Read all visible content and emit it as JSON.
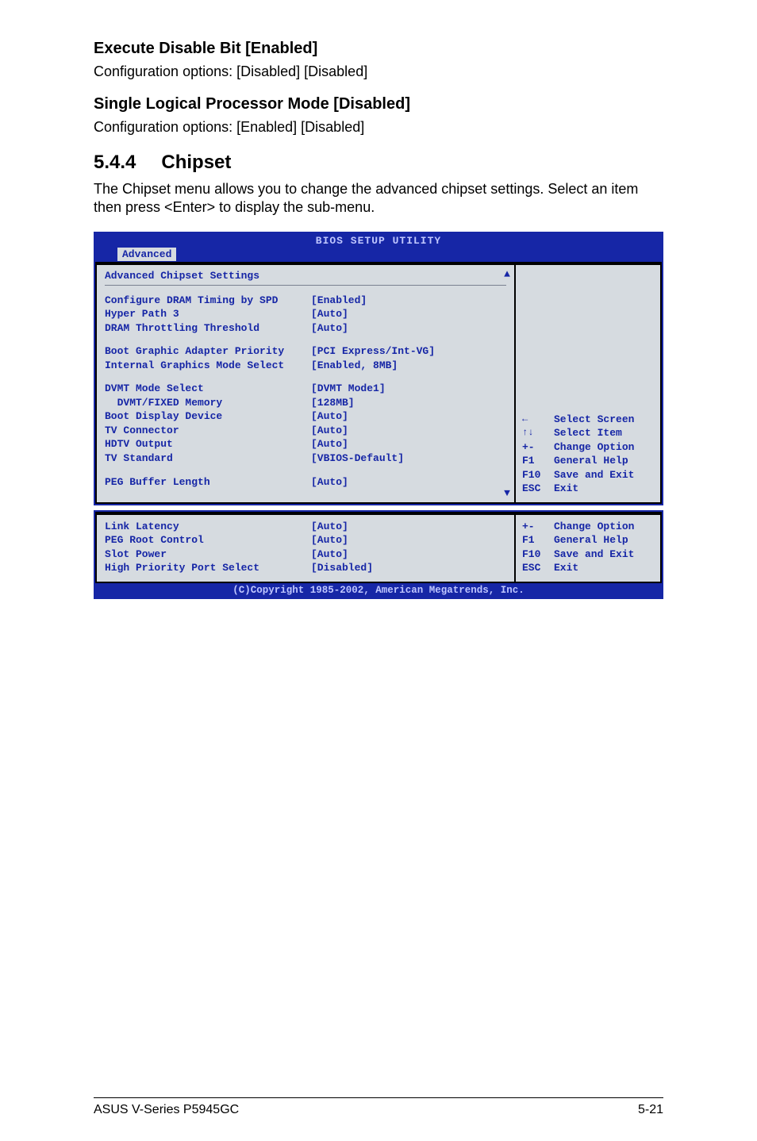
{
  "headings": {
    "h1": "Execute Disable Bit [Enabled]",
    "h1_body": "Configuration options: [Disabled] [Disabled]",
    "h2": "Single Logical Processor Mode [Disabled]",
    "h2_body": "Configuration options: [Enabled] [Disabled]",
    "sec_num": "5.4.4",
    "sec_title": "Chipset",
    "sec_body": "The Chipset menu allows you to change the advanced chipset settings. Select an item then press <Enter> to display the sub-menu."
  },
  "bios": {
    "title": "BIOS SETUP UTILITY",
    "tab": "Advanced",
    "panel_title": "Advanced Chipset Settings",
    "settings1": [
      {
        "label": "Configure DRAM Timing by SPD",
        "value": "[Enabled]"
      },
      {
        "label": "Hyper Path 3",
        "value": "[Auto]"
      },
      {
        "label": "DRAM Throttling Threshold",
        "value": "[Auto]"
      }
    ],
    "settings2": [
      {
        "label": "Boot Graphic Adapter Priority",
        "value": "[PCI Express/Int-VG]"
      },
      {
        "label": "Internal Graphics Mode Select",
        "value": "[Enabled, 8MB]"
      }
    ],
    "settings3": [
      {
        "label": "DVMT Mode Select",
        "value": "[DVMT Mode1]"
      },
      {
        "label": "  DVMT/FIXED Memory",
        "value": "[128MB]"
      },
      {
        "label": "Boot Display Device",
        "value": "[Auto]"
      },
      {
        "label": "TV Connector",
        "value": "[Auto]"
      },
      {
        "label": "HDTV Output",
        "value": "[Auto]"
      },
      {
        "label": "TV Standard",
        "value": "[VBIOS-Default]"
      }
    ],
    "settings4": [
      {
        "label": "PEG Buffer Length",
        "value": "[Auto]"
      }
    ],
    "help1": [
      {
        "key": "←",
        "text": "Select Screen"
      },
      {
        "key": "↑↓",
        "text": "Select Item"
      },
      {
        "key": "+-",
        "text": "Change Option"
      },
      {
        "key": "F1",
        "text": "General Help"
      },
      {
        "key": "F10",
        "text": "Save and Exit"
      },
      {
        "key": "ESC",
        "text": "Exit"
      }
    ],
    "settings5": [
      {
        "label": "Link Latency",
        "value": "[Auto]"
      },
      {
        "label": "PEG Root Control",
        "value": "[Auto]"
      },
      {
        "label": "Slot Power",
        "value": "[Auto]"
      },
      {
        "label": "High Priority Port Select",
        "value": "[Disabled]"
      }
    ],
    "help2": [
      {
        "key": "+-",
        "text": "Change Option"
      },
      {
        "key": "F1",
        "text": "General Help"
      },
      {
        "key": "F10",
        "text": "Save and Exit"
      },
      {
        "key": "ESC",
        "text": "Exit"
      }
    ],
    "copyright": "(C)Copyright 1985-2002, American Megatrends, Inc."
  },
  "footer": {
    "left": "ASUS V-Series P5945GC",
    "right": "5-21"
  }
}
